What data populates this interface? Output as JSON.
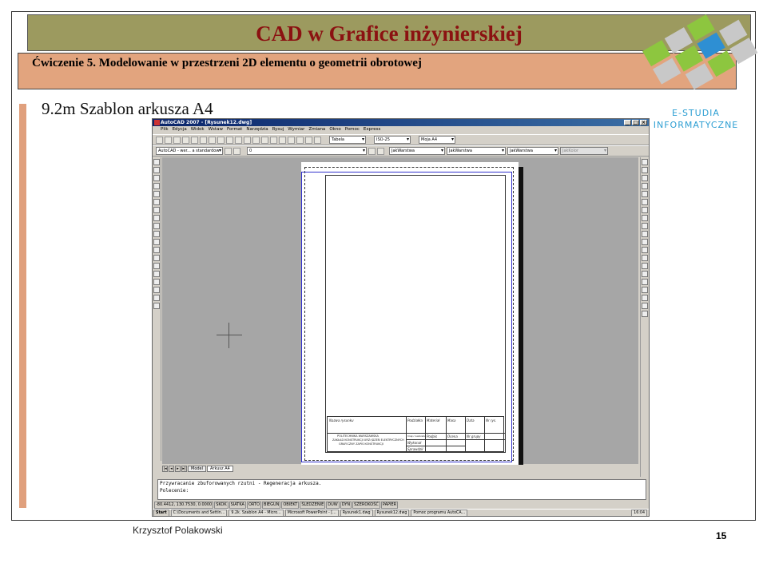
{
  "slide": {
    "title": "CAD w Grafice inżynierskiej",
    "subtitle": "Ćwiczenie 5. Modelowanie w przestrzeni 2D elementu o geometrii obrotowej",
    "heading": "9.2m Szablon  arkusza A4",
    "logo_line1": "E-STUDIA",
    "logo_line2": "INFORMATYCZNE",
    "author": "Krzysztof Polakowski",
    "page_number": "15"
  },
  "acad": {
    "window_title": "AutoCAD 2007 - [Rysunek12.dwg]",
    "menu": [
      "Plik",
      "Edycja",
      "Widok",
      "Wstaw",
      "Format",
      "Narzędzia",
      "Rysuj",
      "Wymiar",
      "Zmiana",
      "Okno",
      "Pomoc",
      "Express"
    ],
    "combo_table": "Tabela",
    "combo_dim": "ISO-25",
    "combo_style": "Moja A4",
    "combo_workspace": "AutoCAD - wer... a standardow",
    "combo_layer": "0",
    "combo_color": "JakWarstwa",
    "combo_linetype": "JakWarstwa",
    "combo_lineweight": "JakWarstwa",
    "combo_plot": "JakKolor",
    "tabs": [
      "Model",
      "Arkusz A4"
    ],
    "command_lines": [
      "Przywracanie zbuforowanych rzutni - Regeneracja arkusza.",
      "Polecenie:"
    ],
    "coords": "-80.4412, 130.7530, 0.0000",
    "status_buttons": [
      "SKOK",
      "SIATKA",
      "ORTO",
      "BIEGUN",
      "OBIEKT",
      "ŚLEDZENIE",
      "DUW",
      "DYN",
      "SZEROKOŚĆ",
      "PAPIER"
    ],
    "taskbar_items": [
      "Start",
      "C:\\Documents and Settin...",
      "9.2k. Szablon A4 - Micro...",
      "Microsoft PowerPoint - [...",
      "Rysunek1.dwg",
      "Rysunek12.dwg",
      "Pomoc programu AutoCA..."
    ],
    "clock": "16:04"
  },
  "title_block": {
    "nazwa": "Nazwa rysunku",
    "podzialka": "Podziałka",
    "material": "Materiał",
    "masa": "Masa",
    "data": "Data",
    "nr_rys": "Nr rys.",
    "school_1": "POLITECHNIKA WARSZAWSKA",
    "school_2": "ZAKŁAD KONSTRUKCJI URZĄDZEŃ ELEKTRYCZNYCH",
    "school_3": "GRAFICZNY ZAPIS KONSTRUKCJI",
    "imie": "Imię i nazwisko",
    "podpis": "Podpis",
    "ocena": "Ocena",
    "nr_grupy": "Nr grupy",
    "wykonal": "Wykonał",
    "sprawdzil": "Sprawdził"
  }
}
